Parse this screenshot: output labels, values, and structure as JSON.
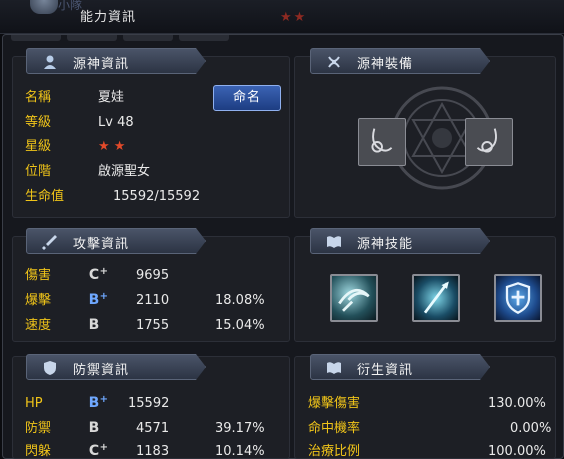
{
  "window": {
    "title": "能力資訊",
    "ghost_text": "小隊"
  },
  "colors": {
    "label_yellow": "#f0c419",
    "star_red": "#e34a2a",
    "button_blue": "#2b4f9c",
    "header_blue": "#3e4a60"
  },
  "source_info": {
    "header": "源神資訊",
    "icon": "person-icon",
    "rename_button": "命名",
    "rows": [
      {
        "label": "名稱",
        "value": "夏娃"
      },
      {
        "label": "等級",
        "value": "Lv 48"
      },
      {
        "label": "星級",
        "stars": 2
      },
      {
        "label": "位階",
        "value": "啟源聖女"
      },
      {
        "label": "生命值",
        "value": "15592/15592"
      }
    ]
  },
  "source_equipment": {
    "header": "源神裝備",
    "icon": "knot-icon",
    "slots": [
      "ring-slot-icon",
      "ring-slot-icon"
    ]
  },
  "attack_info": {
    "header": "攻擊資訊",
    "icon": "sword-icon",
    "rows": [
      {
        "label": "傷害",
        "grade": "C+",
        "value": "9695",
        "percent": ""
      },
      {
        "label": "爆擊",
        "grade": "B+",
        "value": "2110",
        "percent": "18.08%"
      },
      {
        "label": "速度",
        "grade": "B",
        "value": "1755",
        "percent": "15.04%"
      }
    ]
  },
  "source_skills": {
    "header": "源神技能",
    "icon": "book-icon",
    "skills": [
      "whirlwind-skill-icon",
      "ice-spear-skill-icon",
      "holy-shield-skill-icon"
    ]
  },
  "defense_info": {
    "header": "防禦資訊",
    "icon": "shield-icon",
    "rows": [
      {
        "label": "HP",
        "grade": "B+",
        "value": "15592",
        "percent": ""
      },
      {
        "label": "防禦",
        "grade": "B",
        "value": "4571",
        "percent": "39.17%"
      },
      {
        "label": "閃躲",
        "grade": "C+",
        "value": "1183",
        "percent": "10.14%"
      }
    ]
  },
  "derived_info": {
    "header": "衍生資訊",
    "icon": "book-icon",
    "rows": [
      {
        "label": "爆擊傷害",
        "value": "130.00%"
      },
      {
        "label": "命中機率",
        "value": "0.00%"
      },
      {
        "label": "治療比例",
        "value": "100.00%"
      }
    ]
  }
}
